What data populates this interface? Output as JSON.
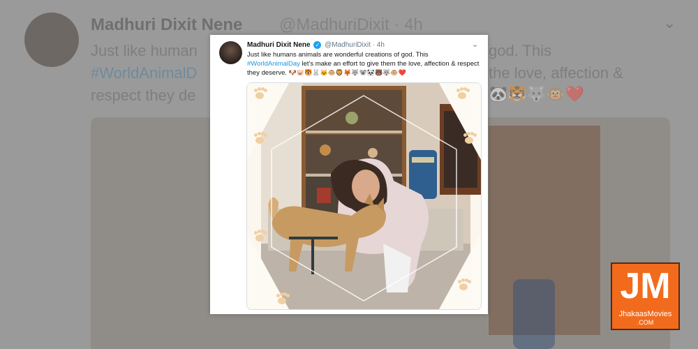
{
  "background": {
    "name": "Madhuri Dixit Nene",
    "handle": "@MadhuriDixit",
    "time": "4h",
    "line1": "Just like human",
    "line2": "#WorldAnimalD",
    "line3": "respect they de",
    "right1": "god. This",
    "right2": "the love, affection &",
    "emoji": "🐼🐯🐺🐵❤️"
  },
  "tweet": {
    "name": "Madhuri Dixit Nene",
    "handle": "@MadhuriDixit",
    "separator": "·",
    "time": "4h",
    "text_part1": "Just like humans animals are wonderful creations of god. This",
    "hashtag": "#WorldAnimalDay",
    "text_part2": "let's make an effort to give them the love, affection & respect they deserve.",
    "emojis": "🐶🐷🐯🐰🐱🐵🦁🦊🐺🐨🐼🐻🐺🐵❤️"
  },
  "icons": {
    "verified": "verified-badge-icon",
    "chevron": "chevron-down-icon"
  },
  "colors": {
    "link": "#1b95e0",
    "verified": "#1da1f2",
    "logo_orange": "#f26b1d"
  },
  "logo": {
    "letters": "JM",
    "line1": "JhakaasMovies",
    "line2": ".COM"
  }
}
